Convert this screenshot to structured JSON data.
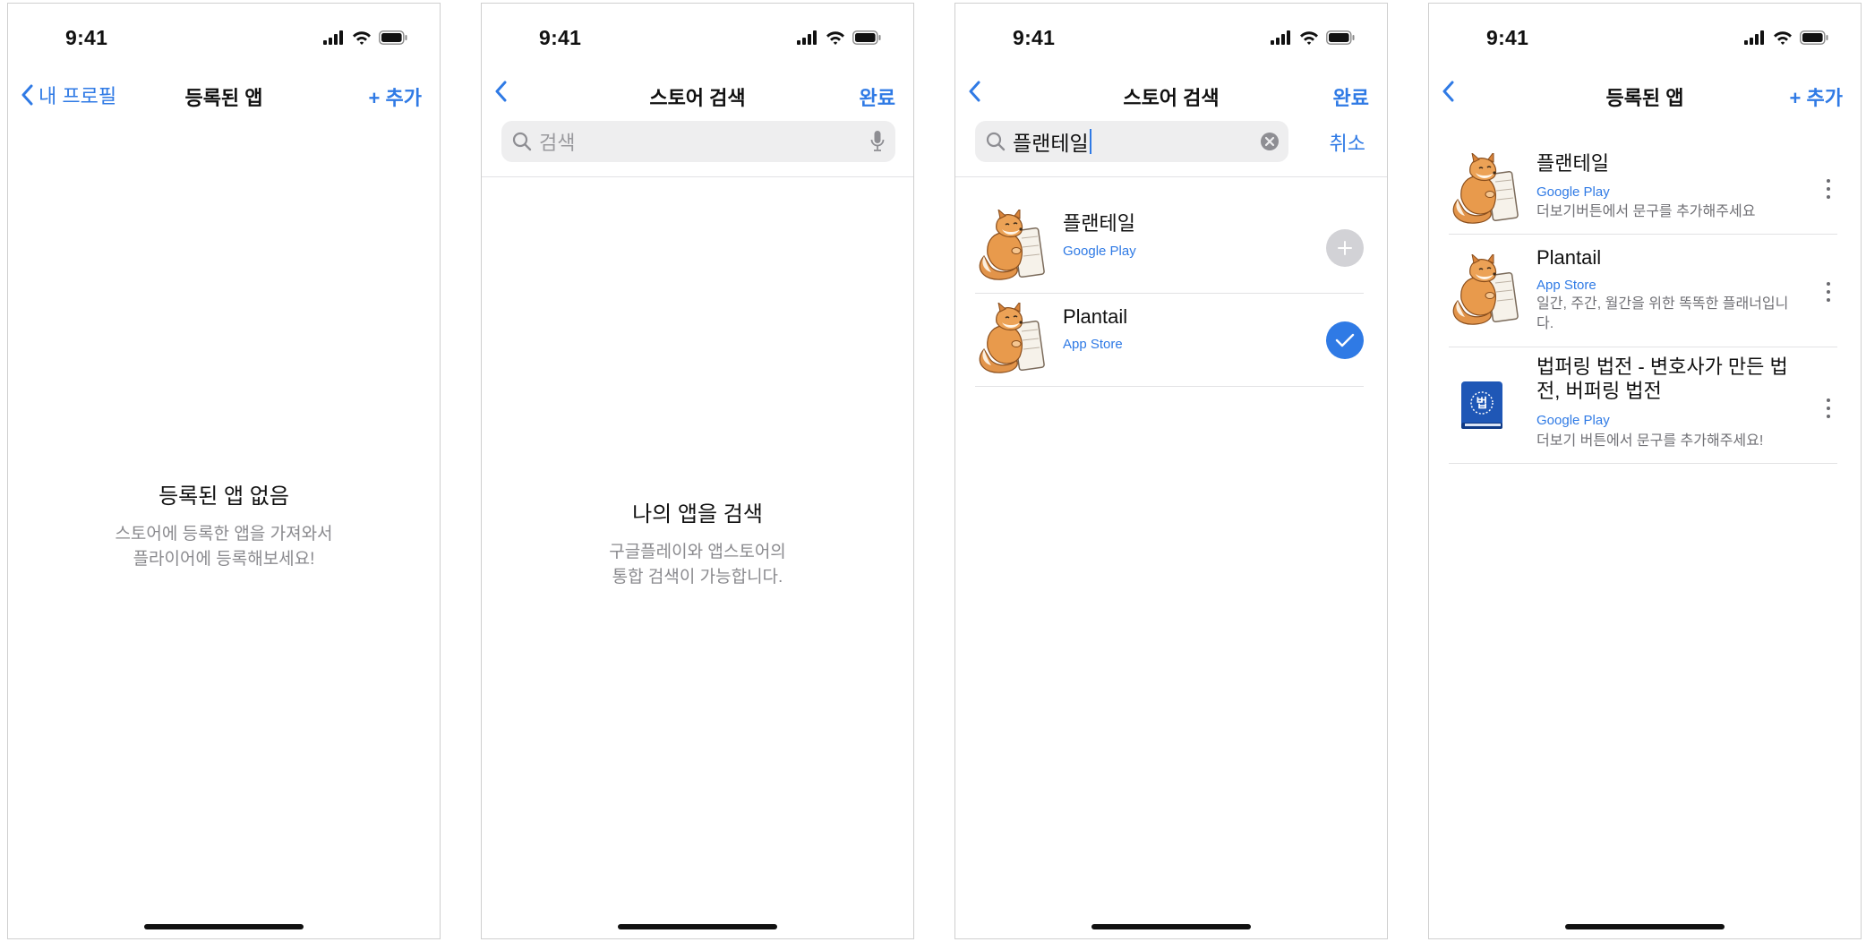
{
  "status": {
    "time": "9:41"
  },
  "colors": {
    "accent": "#2f7ae5",
    "secondary_text": "#8a8a8e",
    "separator": "#e2e2e4"
  },
  "screen1": {
    "nav": {
      "back_label": "내 프로필",
      "title": "등록된 앱",
      "right_label": "+ 추가"
    },
    "empty": {
      "title": "등록된 앱 없음",
      "desc": "스토어에 등록한 앱을 가져와서\n플라이어에 등록해보세요!"
    }
  },
  "screen2": {
    "nav": {
      "title": "스토어 검색",
      "right_label": "완료"
    },
    "search": {
      "placeholder": "검색"
    },
    "empty": {
      "title": "나의 앱을 검색",
      "desc": "구글플레이와 앱스토어의\n통합 검색이 가능합니다."
    }
  },
  "screen3": {
    "nav": {
      "title": "스토어 검색",
      "right_label": "완료"
    },
    "search": {
      "value": "플랜테일",
      "cancel_label": "취소"
    },
    "results": [
      {
        "name": "플랜테일",
        "store": "Google Play",
        "icon": "fox-notebook-icon",
        "state": "add"
      },
      {
        "name": "Plantail",
        "store": "App Store",
        "icon": "fox-notebook-icon",
        "state": "selected"
      }
    ]
  },
  "screen4": {
    "nav": {
      "title": "등록된 앱",
      "right_label": "+ 추가"
    },
    "apps": [
      {
        "name": "플랜테일",
        "store": "Google Play",
        "desc": "더보기버튼에서 문구를 추가해주세요",
        "icon": "fox-notebook-icon"
      },
      {
        "name": "Plantail",
        "store": "App Store",
        "desc": "일간, 주간, 월간을 위한 똑똑한 플래너입니다.",
        "icon": "fox-notebook-icon"
      },
      {
        "name": "법퍼링 법전 - 변호사가 만든 법전, 버퍼링 법전",
        "store": "Google Play",
        "desc": "더보기 버튼에서 문구를 추가해주세요!",
        "icon": "law-book-icon",
        "icon_label": "법"
      }
    ]
  }
}
